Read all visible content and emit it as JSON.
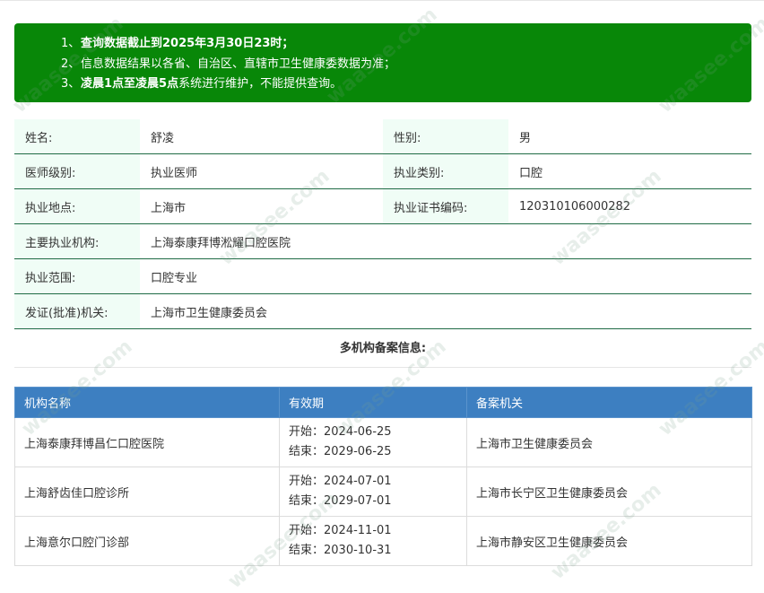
{
  "notice": {
    "items": [
      {
        "num": "1、",
        "text": "查询数据截止到2025年3月30日23时；"
      },
      {
        "num": "2、",
        "text": "信息数据结果以各省、自治区、直辖市卫生健康委数据为准；"
      },
      {
        "num": "3、",
        "text_bold": "凌晨1点至凌晨5点",
        "text": "系统进行维护，不能提供查询。"
      }
    ]
  },
  "info": {
    "name_label": "姓名:",
    "name": "舒凌",
    "gender_label": "性别:",
    "gender": "男",
    "level_label": "医师级别:",
    "level": "执业医师",
    "category_label": "执业类别:",
    "category": "口腔",
    "location_label": "执业地点:",
    "location": "上海市",
    "cert_label": "执业证书编码:",
    "cert": "120310106000282",
    "institution_label": "主要执业机构:",
    "institution": "上海泰康拜博淞耀口腔医院",
    "scope_label": "执业范围:",
    "scope": "口腔专业",
    "issuer_label": "发证(批准)机关:",
    "issuer": "上海市卫生健康委员会"
  },
  "multi_title": "多机构备案信息:",
  "orgs": {
    "headers": [
      "机构名称",
      "有效期",
      "备案机关"
    ],
    "rows": [
      {
        "name": "上海泰康拜博昌仁口腔医院",
        "start": "开始：2024-06-25",
        "end": "结束：2029-06-25",
        "authority": "上海市卫生健康委员会"
      },
      {
        "name": "上海舒齿佳口腔诊所",
        "start": "开始：2024-07-01",
        "end": "结束：2029-07-01",
        "authority": "上海市长宁区卫生健康委员会"
      },
      {
        "name": "上海意尔口腔门诊部",
        "start": "开始：2024-11-01",
        "end": "结束：2030-10-31",
        "authority": "上海市静安区卫生健康委员会"
      }
    ]
  },
  "watermark": "waasee.com",
  "colors": {
    "notice_bg": "#088708",
    "label_bg": "#f0fdf6",
    "header_bg": "#3d7fc1",
    "row_border": "#1f6b45"
  }
}
